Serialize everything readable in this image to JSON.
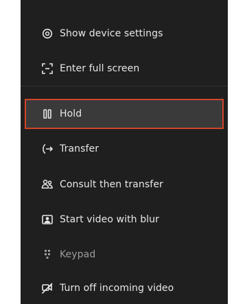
{
  "menu": {
    "items": [
      {
        "label": "Show device settings",
        "icon": "gear-icon"
      },
      {
        "label": "Enter full screen",
        "icon": "fullscreen-icon"
      },
      {
        "label": "Hold",
        "icon": "pause-icon",
        "selected": true
      },
      {
        "label": "Transfer",
        "icon": "transfer-icon"
      },
      {
        "label": "Consult then transfer",
        "icon": "consult-icon"
      },
      {
        "label": "Start video with blur",
        "icon": "blur-video-icon"
      },
      {
        "label": "Keypad",
        "icon": "keypad-icon",
        "dimmed": true
      },
      {
        "label": "Turn off incoming video",
        "icon": "video-off-icon"
      }
    ]
  },
  "colors": {
    "background": "#1f1f1f",
    "text": "#e8e8e8",
    "selected_background": "#3a3a3a",
    "selected_border": "#d2452a"
  }
}
